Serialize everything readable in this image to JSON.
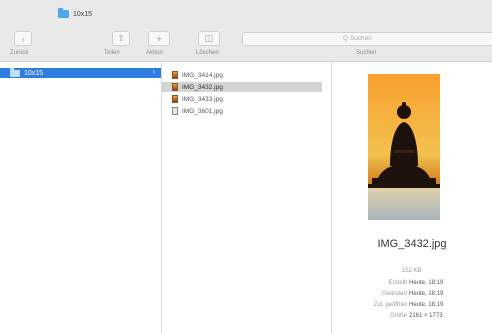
{
  "window": {
    "title": "10x15"
  },
  "toolbar": {
    "labels": [
      "Zurück",
      "Teilen",
      "Aktion",
      "Löschen",
      "Suchen"
    ],
    "search_placeholder": "Q Suchen"
  },
  "sidebar": {
    "items": [
      {
        "label": "10x15",
        "selected": true
      }
    ]
  },
  "files": [
    {
      "name": "IMG_3414.jpg",
      "icon": "image-file-icon",
      "selected": false
    },
    {
      "name": "IMG_3432.jpg",
      "icon": "image-file-icon",
      "selected": true
    },
    {
      "name": "IMG_3433.jpg",
      "icon": "image-file-icon",
      "selected": false
    },
    {
      "name": "IMG_3601.jpg",
      "icon": "doc-file-icon",
      "selected": false
    }
  ],
  "preview": {
    "filename": "IMG_3432.jpg",
    "size": "152 KB",
    "meta": [
      {
        "key": "Erstellt",
        "value": "Heute, 18:19"
      },
      {
        "key": "Geändert",
        "value": "Heute, 18:19"
      },
      {
        "key": "Zul. geöffnet",
        "value": "Heute, 18:19"
      },
      {
        "key": "Größe",
        "value": "2161 × 1773"
      }
    ]
  },
  "colors": {
    "selection_blue": "#2f7de1",
    "selection_gray": "#d4d4d4",
    "folder": "#4ea8e8"
  }
}
